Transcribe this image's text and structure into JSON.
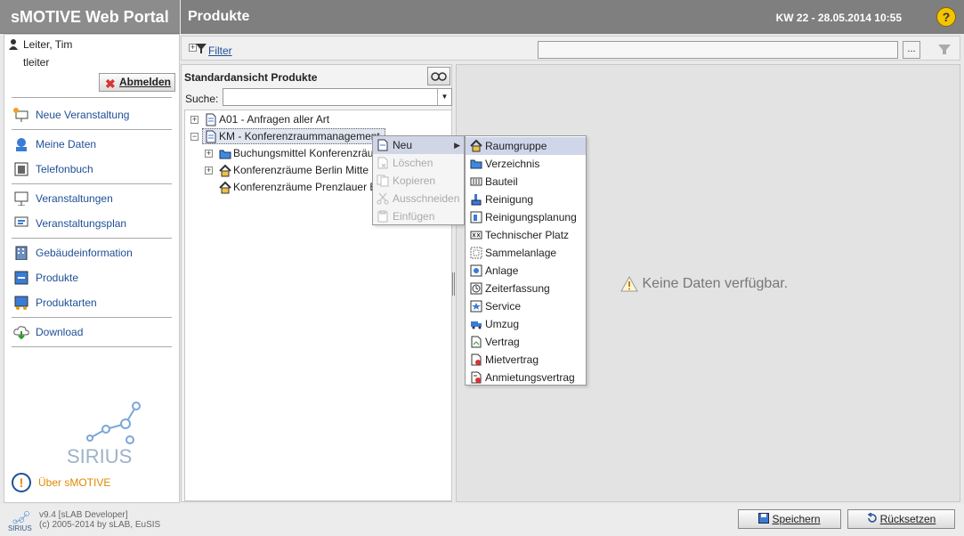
{
  "app": {
    "title": "sMOTIVE Web Portal"
  },
  "header": {
    "page_title": "Produkte",
    "datetime": "KW 22 - 28.05.2014 10:55",
    "help_glyph": "?"
  },
  "user": {
    "name": "Leiter, Tim",
    "login": "tleiter",
    "logout_label": "Abmelden"
  },
  "sidebar": {
    "items": [
      {
        "label": "Neue Veranstaltung",
        "icon": "new-event-icon"
      },
      {
        "label": "Meine Daten",
        "icon": "user-data-icon"
      },
      {
        "label": "Telefonbuch",
        "icon": "phonebook-icon"
      },
      {
        "label": "Veranstaltungen",
        "icon": "events-icon"
      },
      {
        "label": "Veranstaltungsplan",
        "icon": "event-plan-icon"
      },
      {
        "label": "Gebäudeinformation",
        "icon": "building-icon"
      },
      {
        "label": "Produkte",
        "icon": "products-icon"
      },
      {
        "label": "Produktarten",
        "icon": "product-types-icon"
      },
      {
        "label": "Download",
        "icon": "download-icon"
      }
    ],
    "about_label": "Über sMOTIVE",
    "logo_text": "SIRIUS"
  },
  "toolbar": {
    "filter_label": "Filter",
    "dots_label": "..."
  },
  "list": {
    "title": "Standardansicht Produkte",
    "search_label": "Suche:",
    "tree": [
      {
        "label": "A01 - Anfragen aller Art",
        "icon": "document-icon"
      },
      {
        "label": "KM - Konferenzraummanagement",
        "icon": "document-icon"
      },
      {
        "label": "Buchungsmittel Konferenzräume",
        "icon": "folder-icon"
      },
      {
        "label": "Konferenzräume Berlin Mitte",
        "icon": "roomgroup-icon"
      },
      {
        "label": "Konferenzräume Prenzlauer Berg",
        "icon": "roomgroup-icon"
      }
    ]
  },
  "detail": {
    "empty_message": "Keine Daten verfügbar."
  },
  "context_menu": {
    "items": [
      {
        "label": "Neu",
        "enabled": true
      },
      {
        "label": "Löschen",
        "enabled": false
      },
      {
        "label": "Kopieren",
        "enabled": false
      },
      {
        "label": "Ausschneiden",
        "enabled": false
      },
      {
        "label": "Einfügen",
        "enabled": false
      }
    ],
    "submenu": [
      "Raumgruppe",
      "Verzeichnis",
      "Bauteil",
      "Reinigung",
      "Reinigungsplanung",
      "Technischer Platz",
      "Sammelanlage",
      "Anlage",
      "Zeiterfassung",
      "Service",
      "Umzug",
      "Vertrag",
      "Mietvertrag",
      "Anmietungsvertrag"
    ]
  },
  "footer": {
    "version": "v9.4 [sLAB Developer]",
    "copyright": "(c) 2005-2014 by sLAB, EuSIS",
    "save_label": "Speichern",
    "reset_label": "Rücksetzen"
  },
  "colors": {
    "header": "#7f7f7f",
    "link": "#1f4f96",
    "highlight": "#cfd6ea",
    "about": "#e08800"
  }
}
